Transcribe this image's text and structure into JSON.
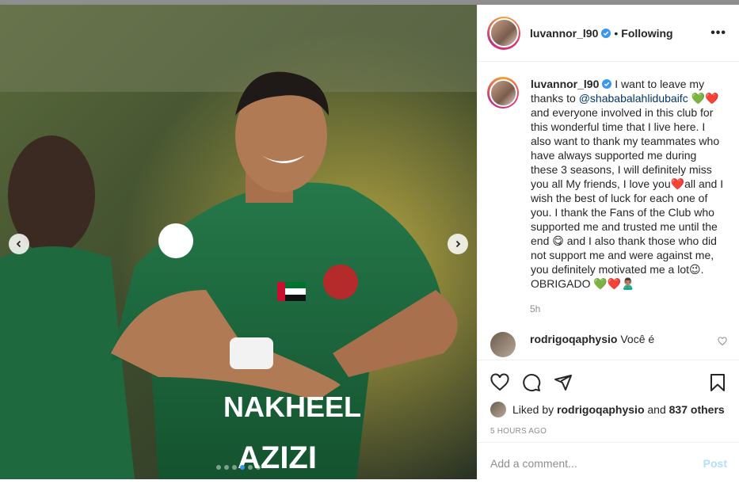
{
  "post": {
    "username": "luvannor_l90",
    "follow_status": "Following",
    "more_label": "•••",
    "caption_before_mention": "I want to leave my thanks to",
    "mention": "@shababalahlidubaifc",
    "caption_emoji_1": "💚❤️",
    "caption_mid": "and everyone involved in this club for this wonderful time that I live here. I also want to thank my teammates who have always supported me during these 3 seasons, I will definitely miss you all My friends, I love you",
    "caption_emoji_2": "❤️",
    "caption_mid2": "all and I wish the best of luck for each one of you. I thank the Fans of the Club who supported me and trusted me until the end",
    "caption_emoji_3": "😋",
    "caption_mid3": "and I also thank those who did not support me and were against me, you definitely motivated me a lot",
    "caption_emoji_4": "😉",
    "caption_end": ". OBRIGADO",
    "caption_emoji_5": "💚❤️🙎🏽‍♂️",
    "caption_age": "5h",
    "photo_jersey_text_1": "NAKHEEL",
    "photo_jersey_text_2": "AZIZI"
  },
  "comment": {
    "username": "rodrigoqaphysio",
    "text": "Você é"
  },
  "likes": {
    "prefix": "Liked by",
    "user": "rodrigoqaphysio",
    "and": "and",
    "count": "837 others"
  },
  "timestamp": "5 HOURS AGO",
  "comment_input": {
    "placeholder": "Add a comment...",
    "post_label": "Post"
  },
  "colors": {
    "accent": "#3897f0",
    "verified": "#3897f0",
    "mention": "#00376b",
    "jersey": "#1f6b3a"
  },
  "icons": [
    "heart-icon",
    "comment-icon",
    "share-icon",
    "save-icon",
    "verified-icon",
    "chevron-left-icon",
    "chevron-right-icon",
    "more-icon"
  ]
}
